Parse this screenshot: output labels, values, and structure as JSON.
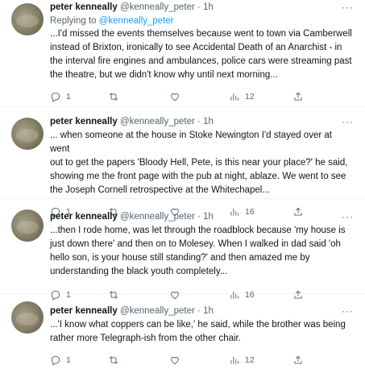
{
  "tweets": [
    {
      "name": "peter kenneally",
      "handle": "@kenneally_peter",
      "sep": "·",
      "time": "1h",
      "more": "···",
      "replying_prefix": "Replying to ",
      "replying_handle": "@kenneally_peter",
      "text": "...I'd missed the events themselves because went to town via Camberwell\ninstead of Brixton, ironically to see Accidental Death of an Anarchist - in\nthe interval fire engines and ambulances, police cars were streaming past\nthe theatre, but we didn't know why until next morning...",
      "replies": "1",
      "retweets": "",
      "likes": "",
      "views": "12"
    },
    {
      "name": "peter kenneally",
      "handle": "@kenneally_peter",
      "sep": "·",
      "time": "1h",
      "more": "···",
      "text": "... when someone at the house in Stoke Newington I'd stayed over at went\nout to get the papers 'Bloody Hell, Pete, is this near your place?' he said,\nshowing me the front page with the pub at night, ablaze. We went to see\nthe Joseph Cornell retrospective at the Whitechapel...",
      "replies": "1",
      "retweets": "",
      "likes": "",
      "views": "16"
    },
    {
      "name": "peter kenneally",
      "handle": "@kenneally_peter",
      "sep": "·",
      "time": "1h",
      "more": "···",
      "text": "...then I rode home, was let through the roadblock because 'my house is\njust down there' and then on to Molesey. When I walked in dad said 'oh\nhello son, is your house still standing?' and then amazed me by\nunderstanding the black youth completely...",
      "replies": "1",
      "retweets": "",
      "likes": "",
      "views": "16"
    },
    {
      "name": "peter kenneally",
      "handle": "@kenneally_peter",
      "sep": "·",
      "time": "1h",
      "more": "···",
      "text": "...'I know what coppers can be like,' he said, while the brother was being\nrather more Telegraph-ish from the other chair.",
      "replies": "1",
      "retweets": "",
      "likes": "",
      "views": "12"
    }
  ]
}
